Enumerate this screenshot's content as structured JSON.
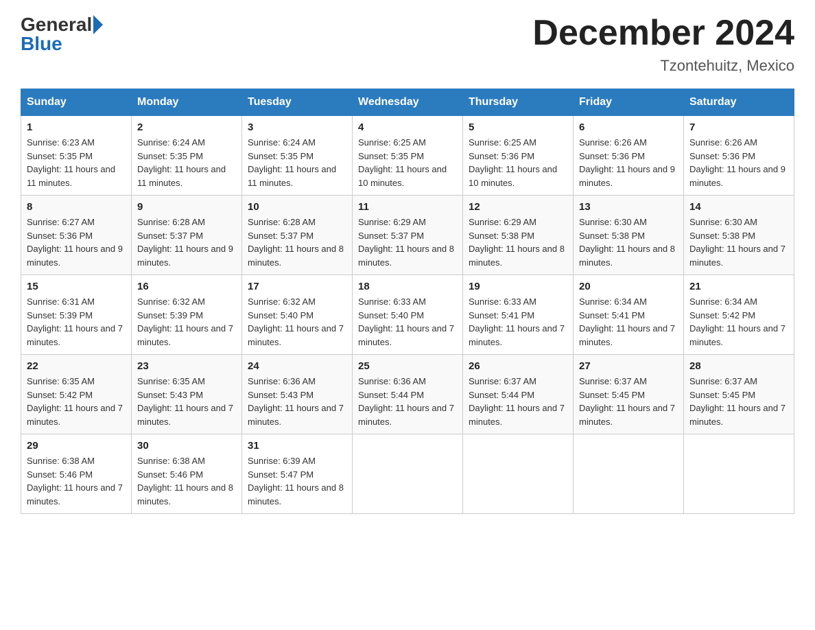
{
  "header": {
    "logo_general": "General",
    "logo_blue": "Blue",
    "title": "December 2024",
    "subtitle": "Tzontehuitz, Mexico"
  },
  "days_of_week": [
    "Sunday",
    "Monday",
    "Tuesday",
    "Wednesday",
    "Thursday",
    "Friday",
    "Saturday"
  ],
  "weeks": [
    [
      {
        "num": "1",
        "sunrise": "6:23 AM",
        "sunset": "5:35 PM",
        "daylight": "11 hours and 11 minutes."
      },
      {
        "num": "2",
        "sunrise": "6:24 AM",
        "sunset": "5:35 PM",
        "daylight": "11 hours and 11 minutes."
      },
      {
        "num": "3",
        "sunrise": "6:24 AM",
        "sunset": "5:35 PM",
        "daylight": "11 hours and 11 minutes."
      },
      {
        "num": "4",
        "sunrise": "6:25 AM",
        "sunset": "5:35 PM",
        "daylight": "11 hours and 10 minutes."
      },
      {
        "num": "5",
        "sunrise": "6:25 AM",
        "sunset": "5:36 PM",
        "daylight": "11 hours and 10 minutes."
      },
      {
        "num": "6",
        "sunrise": "6:26 AM",
        "sunset": "5:36 PM",
        "daylight": "11 hours and 9 minutes."
      },
      {
        "num": "7",
        "sunrise": "6:26 AM",
        "sunset": "5:36 PM",
        "daylight": "11 hours and 9 minutes."
      }
    ],
    [
      {
        "num": "8",
        "sunrise": "6:27 AM",
        "sunset": "5:36 PM",
        "daylight": "11 hours and 9 minutes."
      },
      {
        "num": "9",
        "sunrise": "6:28 AM",
        "sunset": "5:37 PM",
        "daylight": "11 hours and 9 minutes."
      },
      {
        "num": "10",
        "sunrise": "6:28 AM",
        "sunset": "5:37 PM",
        "daylight": "11 hours and 8 minutes."
      },
      {
        "num": "11",
        "sunrise": "6:29 AM",
        "sunset": "5:37 PM",
        "daylight": "11 hours and 8 minutes."
      },
      {
        "num": "12",
        "sunrise": "6:29 AM",
        "sunset": "5:38 PM",
        "daylight": "11 hours and 8 minutes."
      },
      {
        "num": "13",
        "sunrise": "6:30 AM",
        "sunset": "5:38 PM",
        "daylight": "11 hours and 8 minutes."
      },
      {
        "num": "14",
        "sunrise": "6:30 AM",
        "sunset": "5:38 PM",
        "daylight": "11 hours and 7 minutes."
      }
    ],
    [
      {
        "num": "15",
        "sunrise": "6:31 AM",
        "sunset": "5:39 PM",
        "daylight": "11 hours and 7 minutes."
      },
      {
        "num": "16",
        "sunrise": "6:32 AM",
        "sunset": "5:39 PM",
        "daylight": "11 hours and 7 minutes."
      },
      {
        "num": "17",
        "sunrise": "6:32 AM",
        "sunset": "5:40 PM",
        "daylight": "11 hours and 7 minutes."
      },
      {
        "num": "18",
        "sunrise": "6:33 AM",
        "sunset": "5:40 PM",
        "daylight": "11 hours and 7 minutes."
      },
      {
        "num": "19",
        "sunrise": "6:33 AM",
        "sunset": "5:41 PM",
        "daylight": "11 hours and 7 minutes."
      },
      {
        "num": "20",
        "sunrise": "6:34 AM",
        "sunset": "5:41 PM",
        "daylight": "11 hours and 7 minutes."
      },
      {
        "num": "21",
        "sunrise": "6:34 AM",
        "sunset": "5:42 PM",
        "daylight": "11 hours and 7 minutes."
      }
    ],
    [
      {
        "num": "22",
        "sunrise": "6:35 AM",
        "sunset": "5:42 PM",
        "daylight": "11 hours and 7 minutes."
      },
      {
        "num": "23",
        "sunrise": "6:35 AM",
        "sunset": "5:43 PM",
        "daylight": "11 hours and 7 minutes."
      },
      {
        "num": "24",
        "sunrise": "6:36 AM",
        "sunset": "5:43 PM",
        "daylight": "11 hours and 7 minutes."
      },
      {
        "num": "25",
        "sunrise": "6:36 AM",
        "sunset": "5:44 PM",
        "daylight": "11 hours and 7 minutes."
      },
      {
        "num": "26",
        "sunrise": "6:37 AM",
        "sunset": "5:44 PM",
        "daylight": "11 hours and 7 minutes."
      },
      {
        "num": "27",
        "sunrise": "6:37 AM",
        "sunset": "5:45 PM",
        "daylight": "11 hours and 7 minutes."
      },
      {
        "num": "28",
        "sunrise": "6:37 AM",
        "sunset": "5:45 PM",
        "daylight": "11 hours and 7 minutes."
      }
    ],
    [
      {
        "num": "29",
        "sunrise": "6:38 AM",
        "sunset": "5:46 PM",
        "daylight": "11 hours and 7 minutes."
      },
      {
        "num": "30",
        "sunrise": "6:38 AM",
        "sunset": "5:46 PM",
        "daylight": "11 hours and 8 minutes."
      },
      {
        "num": "31",
        "sunrise": "6:39 AM",
        "sunset": "5:47 PM",
        "daylight": "11 hours and 8 minutes."
      },
      null,
      null,
      null,
      null
    ]
  ]
}
